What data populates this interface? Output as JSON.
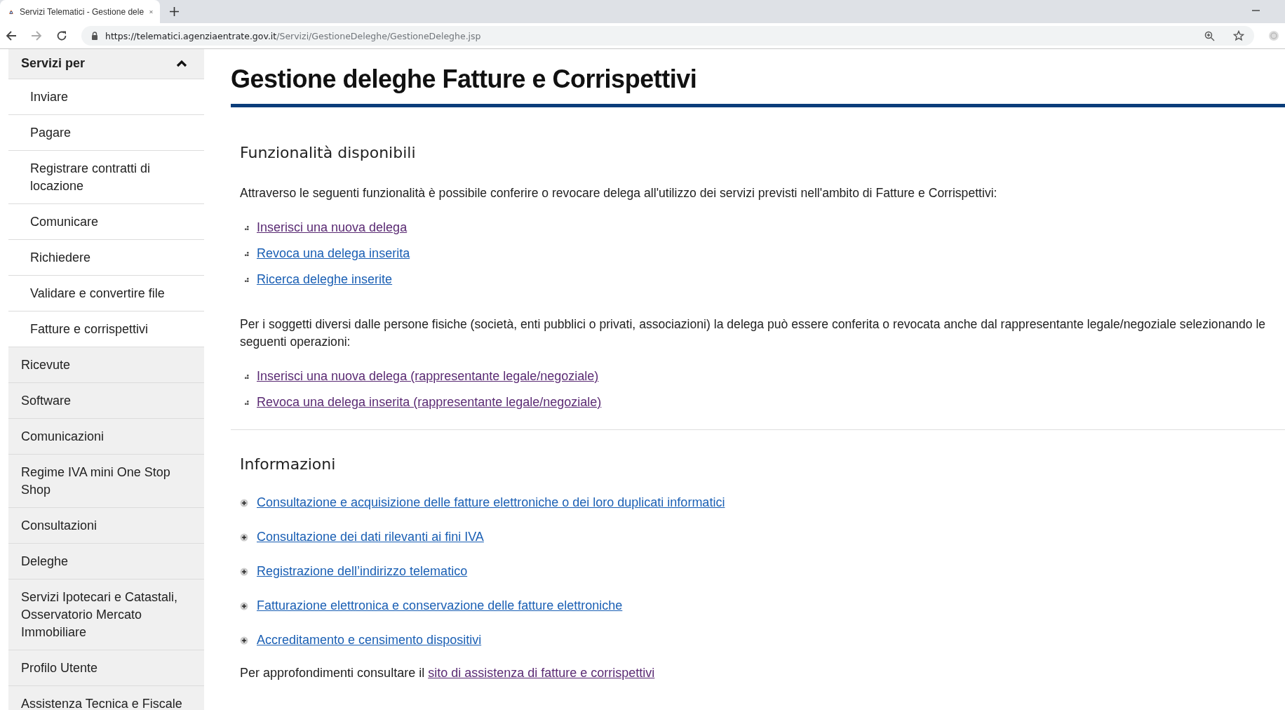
{
  "browser": {
    "tab_title": "Servizi Telematici - Gestione dele",
    "url_host": "https://telematici.agenziaentrate.gov.it",
    "url_path": "/Servizi/GestioneDeleghe/GestioneDeleghe.jsp"
  },
  "sidebar": {
    "items": [
      {
        "label": "Servizi per",
        "expanded": true,
        "children": [
          {
            "label": "Inviare"
          },
          {
            "label": "Pagare"
          },
          {
            "label": "Registrare contratti di locazione"
          },
          {
            "label": "Comunicare"
          },
          {
            "label": "Richiedere"
          },
          {
            "label": "Validare e convertire file"
          },
          {
            "label": "Fatture e corrispettivi"
          }
        ]
      },
      {
        "label": "Ricevute"
      },
      {
        "label": "Software"
      },
      {
        "label": "Comunicazioni"
      },
      {
        "label": "Regime IVA mini One Stop Shop"
      },
      {
        "label": "Consultazioni"
      },
      {
        "label": "Deleghe"
      },
      {
        "label": "Servizi Ipotecari e Catastali, Osservatorio Mercato Immobiliare"
      },
      {
        "label": "Profilo Utente"
      },
      {
        "label": "Assistenza Tecnica e Fiscale"
      }
    ]
  },
  "page_title": "Gestione deleghe Fatture e Corrispettivi",
  "functions": {
    "heading": "Funzionalità disponibili",
    "intro": "Attraverso le seguenti funzionalità è possibile conferire o revocare delega all'utilizzo dei servizi previsti nell'ambito di Fatture e Corrispettivi:",
    "links": [
      {
        "label": "Inserisci una nuova delega",
        "visited": true
      },
      {
        "label": "Revoca una delega inserita",
        "visited": false
      },
      {
        "label": "Ricerca deleghe inserite",
        "visited": false
      }
    ],
    "intro_2": "Per i soggetti diversi dalle persone fisiche (società, enti pubblici o privati, associazioni) la delega può essere conferita o revocata anche dal rappresentante legale/negoziale selezionando le seguenti operazioni:",
    "links_2": [
      {
        "label": "Inserisci una nuova delega (rappresentante legale/negoziale)",
        "visited": true
      },
      {
        "label": "Revoca una delega inserita (rappresentante legale/negoziale)",
        "visited": true
      }
    ]
  },
  "information": {
    "heading": "Informazioni",
    "links": [
      {
        "label": "Consultazione e acquisizione delle fatture elettroniche o dei loro duplicati informatici",
        "visited": false
      },
      {
        "label": "Consultazione dei dati rilevanti ai fini IVA",
        "visited": false
      },
      {
        "label": "Registrazione dell’indirizzo telematico",
        "visited": false
      },
      {
        "label": "Fatturazione elettronica e conservazione delle fatture elettroniche",
        "visited": false
      },
      {
        "label": "Accreditamento e censimento dispositivi",
        "visited": false
      }
    ],
    "footer_text": "Per approfondimenti consultare il",
    "footer_link": {
      "label": "sito di assistenza di fatture e corrispettivi",
      "visited": true
    }
  }
}
